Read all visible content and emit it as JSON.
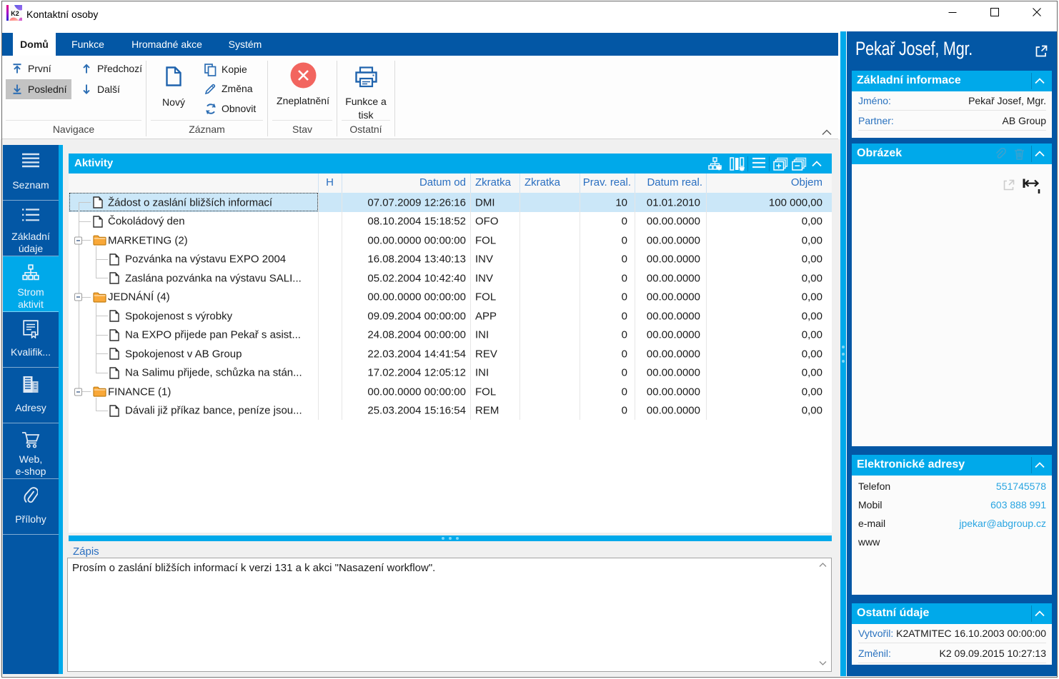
{
  "window": {
    "title": "Kontaktní osoby",
    "app_icon": "K2"
  },
  "ribbon": {
    "tabs": [
      {
        "label": "Domů",
        "active": true
      },
      {
        "label": "Funkce",
        "active": false
      },
      {
        "label": "Hromadné akce",
        "active": false
      },
      {
        "label": "Systém",
        "active": false
      }
    ],
    "groups": [
      {
        "label": "Navigace"
      },
      {
        "label": "Záznam"
      },
      {
        "label": "Stav"
      },
      {
        "label": "Ostatní"
      }
    ],
    "nav_buttons": [
      {
        "label": "První",
        "icon": "arrow-top"
      },
      {
        "label": "Předchozí",
        "icon": "arrow-up"
      },
      {
        "label": "Poslední",
        "icon": "arrow-bottom",
        "highlighted": true
      },
      {
        "label": "Další",
        "icon": "arrow-down"
      }
    ],
    "novy_label": "Nový",
    "small_buttons": [
      {
        "label": "Kopie",
        "icon": "copy"
      },
      {
        "label": "Změna",
        "icon": "pencil"
      },
      {
        "label": "Obnovit",
        "icon": "refresh"
      }
    ],
    "zneplatneni_label": "Zneplatnění",
    "funkce_label_1": "Funkce a",
    "funkce_label_2": "tisk"
  },
  "sidebar": {
    "items": [
      {
        "label": "Seznam",
        "icon": "menu",
        "lines": [
          "Seznam"
        ]
      },
      {
        "label": "Základní údaje",
        "icon": "list",
        "lines": [
          "Základní",
          "údaje"
        ]
      },
      {
        "label": "Strom aktivit",
        "icon": "tree",
        "lines": [
          "Strom",
          "aktivit"
        ],
        "active": true
      },
      {
        "label": "Kvalifik...",
        "icon": "certificate",
        "lines": [
          "Kvalifik..."
        ]
      },
      {
        "label": "Adresy",
        "icon": "buildings",
        "lines": [
          "Adresy"
        ]
      },
      {
        "label": "Web, e-shop",
        "icon": "cart",
        "lines": [
          "Web,",
          "e-shop"
        ]
      },
      {
        "label": "Přílohy",
        "icon": "paperclip",
        "lines": [
          "Přílohy"
        ]
      }
    ]
  },
  "activities": {
    "title": "Aktivity",
    "toolbar_icons": [
      "tree-view",
      "columns",
      "menu-lines",
      "expand-all",
      "collapse-all",
      "collapse-panel"
    ],
    "columns": [
      "H",
      "Datum od",
      "Zkratka",
      "Zkratka",
      "Prav. real.",
      "Datum real.",
      "Objem"
    ],
    "rows": [
      {
        "type": "doc",
        "level": 0,
        "name": "Žádost o zaslání bližších informací",
        "h": "",
        "datum_od": "07.07.2009 12:26:16",
        "zkratka": "DMI",
        "zkratka2": "",
        "prav_real": "10",
        "datum_real": "01.01.2010",
        "objem": "100 000,00",
        "selected": true
      },
      {
        "type": "doc",
        "level": 0,
        "name": "Čokoládový den",
        "h": "",
        "datum_od": "08.10.2004 15:18:52",
        "zkratka": "OFO",
        "zkratka2": "",
        "prav_real": "0",
        "datum_real": "00.00.0000",
        "objem": "0,00"
      },
      {
        "type": "folder",
        "level": 0,
        "name": "MARKETING (2)",
        "h": "",
        "datum_od": "00.00.0000 00:00:00",
        "zkratka": "FOL",
        "zkratka2": "",
        "prav_real": "0",
        "datum_real": "00.00.0000",
        "objem": "0,00",
        "expander": true
      },
      {
        "type": "doc",
        "level": 1,
        "name": "Pozvánka na výstavu EXPO 2004",
        "h": "",
        "datum_od": "16.08.2004 13:40:13",
        "zkratka": "INV",
        "zkratka2": "",
        "prav_real": "0",
        "datum_real": "00.00.0000",
        "objem": "0,00"
      },
      {
        "type": "doc",
        "level": 1,
        "name": "Zaslána pozvánka na výstavu SALI...",
        "h": "",
        "datum_od": "05.02.2004 10:42:40",
        "zkratka": "INV",
        "zkratka2": "",
        "prav_real": "0",
        "datum_real": "00.00.0000",
        "objem": "0,00"
      },
      {
        "type": "folder",
        "level": 0,
        "name": "JEDNÁNÍ (4)",
        "h": "",
        "datum_od": "00.00.0000 00:00:00",
        "zkratka": "FOL",
        "zkratka2": "",
        "prav_real": "0",
        "datum_real": "00.00.0000",
        "objem": "0,00",
        "expander": true
      },
      {
        "type": "doc",
        "level": 1,
        "name": "Spokojenost s výrobky",
        "h": "",
        "datum_od": "09.09.2004 00:00:00",
        "zkratka": "APP",
        "zkratka2": "",
        "prav_real": "0",
        "datum_real": "00.00.0000",
        "objem": "0,00"
      },
      {
        "type": "doc",
        "level": 1,
        "name": "Na EXPO přijede pan Pekař s asist...",
        "h": "",
        "datum_od": "24.08.2004 00:00:00",
        "zkratka": "INI",
        "zkratka2": "",
        "prav_real": "0",
        "datum_real": "00.00.0000",
        "objem": "0,00"
      },
      {
        "type": "doc",
        "level": 1,
        "name": "Spokojenost v AB Group",
        "h": "",
        "datum_od": "22.03.2004 14:41:54",
        "zkratka": "REV",
        "zkratka2": "",
        "prav_real": "0",
        "datum_real": "00.00.0000",
        "objem": "0,00"
      },
      {
        "type": "doc",
        "level": 1,
        "name": "Na Salimu přijede, schůzka na stán...",
        "h": "",
        "datum_od": "17.02.2004 12:05:12",
        "zkratka": "INI",
        "zkratka2": "",
        "prav_real": "0",
        "datum_real": "00.00.0000",
        "objem": "0,00"
      },
      {
        "type": "folder",
        "level": 0,
        "name": "FINANCE (1)",
        "h": "",
        "datum_od": "00.00.0000 00:00:00",
        "zkratka": "FOL",
        "zkratka2": "",
        "prav_real": "0",
        "datum_real": "00.00.0000",
        "objem": "0,00",
        "expander": true
      },
      {
        "type": "doc",
        "level": 1,
        "name": "Dávali již příkaz bance, peníze jsou...",
        "h": "",
        "datum_od": "25.03.2004 15:16:54",
        "zkratka": "REM",
        "zkratka2": "",
        "prav_real": "0",
        "datum_real": "00.00.0000",
        "objem": "0,00"
      }
    ]
  },
  "zapis": {
    "label": "Zápis",
    "text": "Prosím o zaslání bližších informací k verzi 131 a k akci \"Nasazení workflow\"."
  },
  "detail": {
    "title": "Pekař Josef, Mgr.",
    "popout_icon": "popout",
    "obrazek_icons": [
      "attach-image",
      "delete-image",
      "open-image",
      "fit-width"
    ],
    "sections": {
      "zakladni": {
        "title": "Základní informace",
        "rows": [
          {
            "label": "Jméno:",
            "value": "Pekař Josef, Mgr."
          },
          {
            "label": "Partner:",
            "value": "AB Group"
          }
        ]
      },
      "obrazek": {
        "title": "Obrázek"
      },
      "adresy": {
        "title": "Elektronické adresy",
        "rows": [
          {
            "label": "Telefon",
            "value": "551745578"
          },
          {
            "label": "Mobil",
            "value": "603 888 991"
          },
          {
            "label": "e-mail",
            "value": "jpekar@abgroup.cz"
          },
          {
            "label": "www",
            "value": ""
          }
        ]
      },
      "ostatni": {
        "title": "Ostatní údaje",
        "rows": [
          {
            "label": "Vytvořil:",
            "value": "K2ATMITEC 16.10.2003 00:00:00"
          },
          {
            "label": "Změnil:",
            "value": "K2 09.09.2015 10:27:13"
          }
        ]
      }
    }
  },
  "colors": {
    "dark_blue": "#0357a5",
    "cyan": "#00a9ea",
    "selected_row": "#cbe7f8",
    "header_text_blue": "#2a6fc0",
    "link_blue": "#29a5e2",
    "folder_orange": "#f7a432",
    "invalid_red": "#f2655f"
  }
}
